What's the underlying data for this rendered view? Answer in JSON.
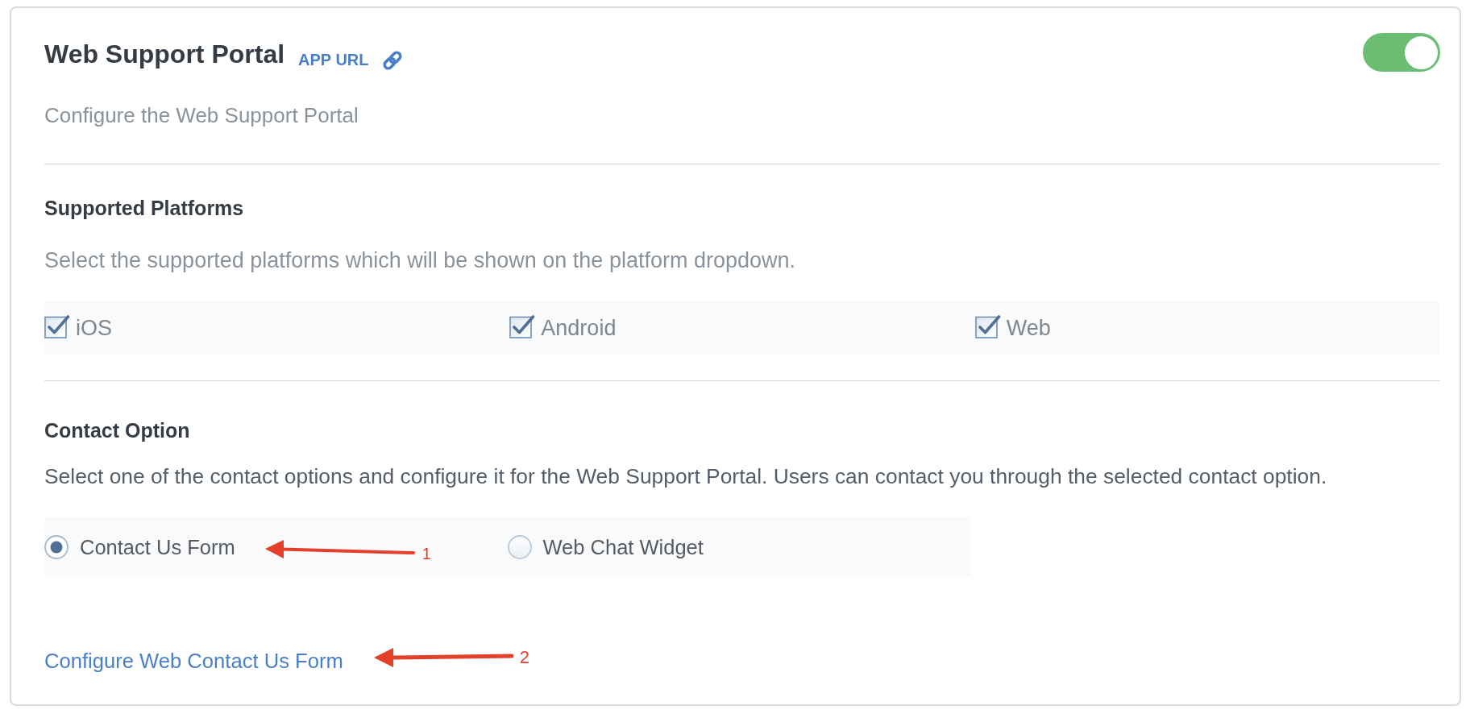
{
  "header": {
    "title": "Web Support Portal",
    "app_url": "APP URL",
    "toggle": {
      "on": true
    },
    "description": "Configure the Web Support Portal"
  },
  "supported_platforms": {
    "heading": "Supported Platforms",
    "description": "Select the supported platforms which will be shown on the platform dropdown.",
    "platforms": [
      {
        "label": "iOS",
        "checked": true
      },
      {
        "label": "Android",
        "checked": true
      },
      {
        "label": "Web",
        "checked": true
      }
    ]
  },
  "contact_option": {
    "heading": "Contact Option",
    "description": "Select one of the contact options and configure it for the Web Support Portal. Users can contact you through the selected contact option.",
    "options": [
      {
        "label": "Contact Us Form",
        "selected": true,
        "annotation": "1"
      },
      {
        "label": "Web Chat Widget",
        "selected": false
      }
    ],
    "configure_link": {
      "label": "Configure Web Contact Us Form",
      "annotation": "2"
    }
  }
}
